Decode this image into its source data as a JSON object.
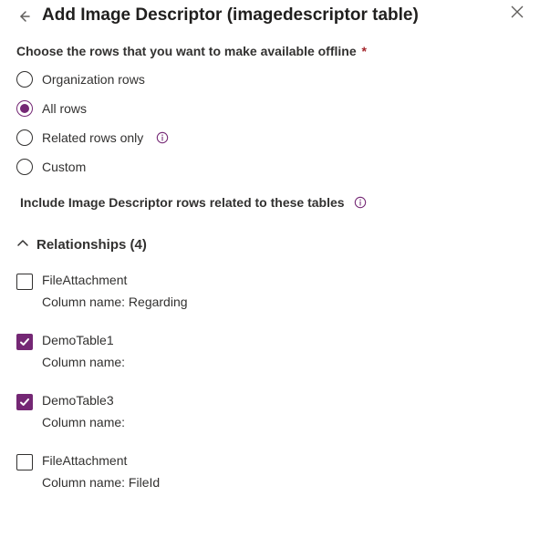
{
  "header": {
    "title": "Add Image Descriptor (imagedescriptor table)"
  },
  "rowChoice": {
    "label": "Choose the rows that you want to make available offline",
    "required_marker": "*",
    "options": [
      {
        "id": "org",
        "label": "Organization rows",
        "selected": false,
        "has_info": false
      },
      {
        "id": "all",
        "label": "All rows",
        "selected": true,
        "has_info": false
      },
      {
        "id": "related",
        "label": "Related rows only",
        "selected": false,
        "has_info": true
      },
      {
        "id": "custom",
        "label": "Custom",
        "selected": false,
        "has_info": false
      }
    ]
  },
  "relatedTables": {
    "label": "Include Image Descriptor rows related to these tables"
  },
  "relationships": {
    "title": "Relationships (4)",
    "expanded": true,
    "column_prefix": "Column name: ",
    "items": [
      {
        "name": "FileAttachment",
        "column": "Regarding",
        "checked": false
      },
      {
        "name": "DemoTable1",
        "column": "",
        "checked": true
      },
      {
        "name": "DemoTable3",
        "column": "",
        "checked": true
      },
      {
        "name": "FileAttachment",
        "column": "FileId",
        "checked": false
      }
    ]
  },
  "colors": {
    "accent": "#742774"
  }
}
